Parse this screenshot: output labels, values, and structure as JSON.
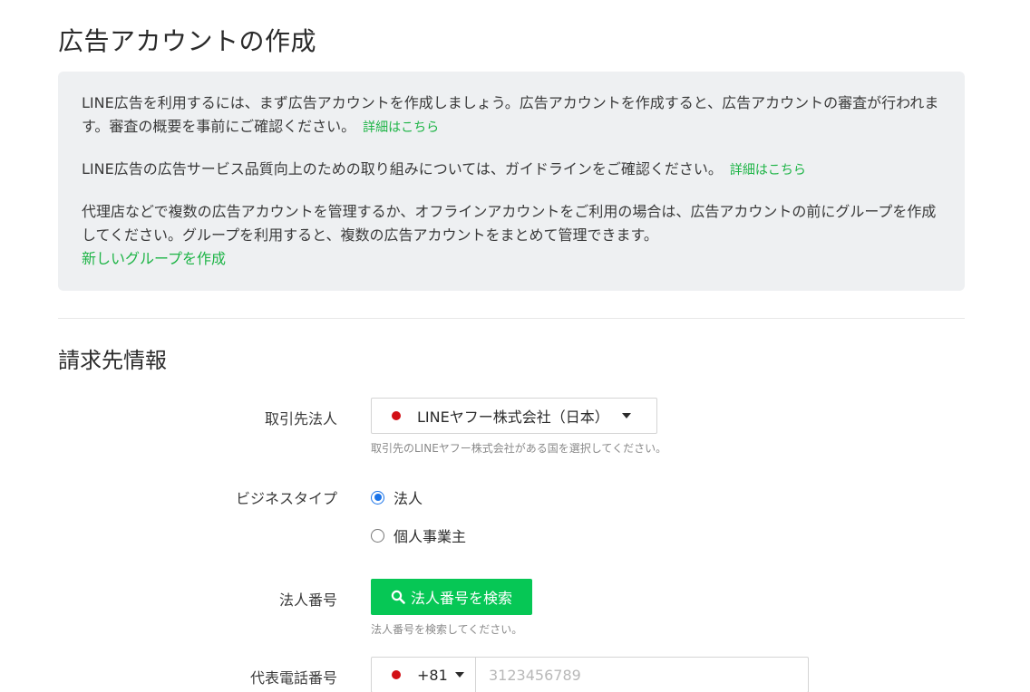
{
  "page": {
    "title": "広告アカウントの作成"
  },
  "info": {
    "p1_text": "LINE広告を利用するには、まず広告アカウントを作成しましょう。広告アカウントを作成すると、広告アカウントの審査が行われます。審査の概要を事前にご確認ください。",
    "p1_link": "詳細はこちら",
    "p2_text": "LINE広告の広告サービス品質向上のための取り組みについては、ガイドラインをご確認ください。",
    "p2_link": "詳細はこちら",
    "p3_text": "代理店などで複数の広告アカウントを管理するか、オフラインアカウントをご利用の場合は、広告アカウントの前にグループを作成してください。グループを利用すると、複数の広告アカウントをまとめて管理できます。",
    "p3_link": "新しいグループを作成"
  },
  "billing": {
    "section_title": "請求先情報",
    "counterparty": {
      "label": "取引先法人",
      "selected": "LINEヤフー株式会社（日本）",
      "hint": "取引先のLINEヤフー株式会社がある国を選択してください。"
    },
    "business_type": {
      "label": "ビジネスタイプ",
      "options": [
        "法人",
        "個人事業主"
      ],
      "selected_index": 0
    },
    "corporate_number": {
      "label": "法人番号",
      "button": "法人番号を検索",
      "hint": "法人番号を検索してください。"
    },
    "phone": {
      "label": "代表電話番号",
      "country_code": "+81",
      "placeholder": "3123456789"
    }
  },
  "colors": {
    "accent_green": "#06c755",
    "link_green": "#1db446",
    "flag_red": "#d20f15",
    "radio_blue": "#1a73e8"
  },
  "icons": [
    "search-icon",
    "chevron-down-icon",
    "flag-dot-icon"
  ]
}
